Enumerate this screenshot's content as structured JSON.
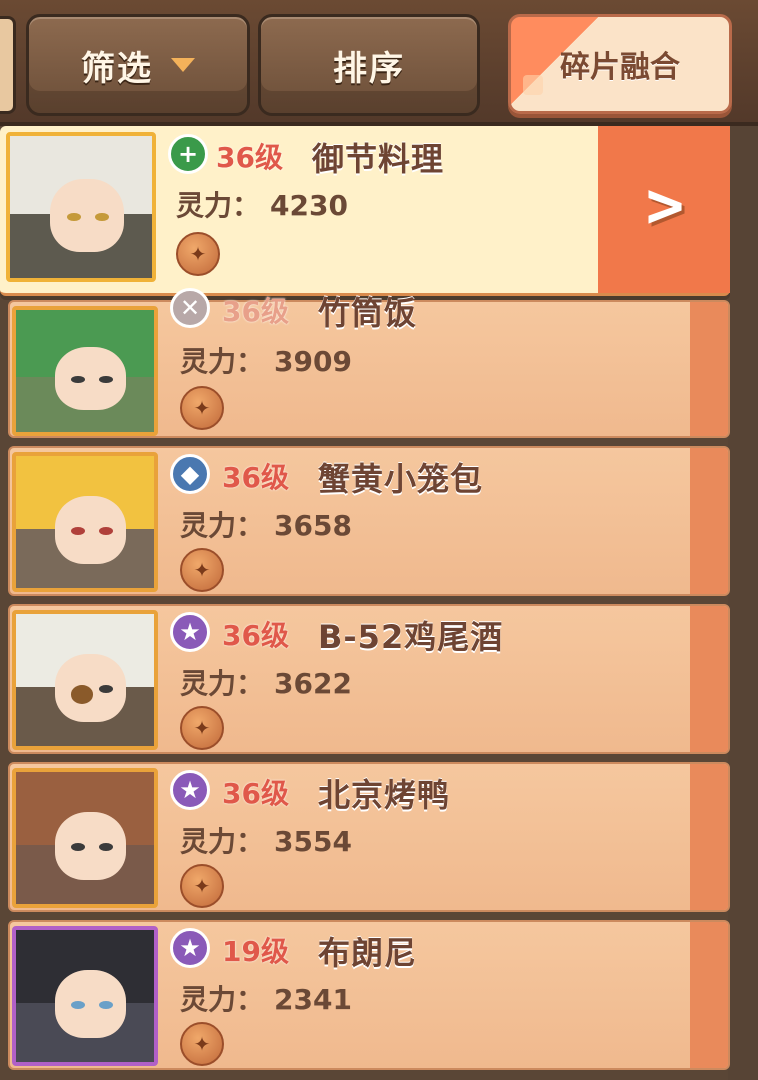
{
  "toolbar": {
    "filter_label": "筛选",
    "sort_label": "排序",
    "fuse_label": "碎片融合"
  },
  "colors": {
    "accent_orange": "#f1784a",
    "level_red": "#e0584a",
    "card_bg": "#f3c59b",
    "selected_bg": "#fff1c9"
  },
  "power_label": "灵力：",
  "characters": [
    {
      "level": "36级",
      "name": "御节料理",
      "power": "4230",
      "class_icon": "plus-icon",
      "selected": true
    },
    {
      "level": "36级",
      "name": "竹筒饭",
      "power": "3909",
      "class_icon": "swords-icon",
      "selected": false
    },
    {
      "level": "36级",
      "name": "蟹黄小笼包",
      "power": "3658",
      "class_icon": "shield-icon",
      "selected": false
    },
    {
      "level": "36级",
      "name": "B-52鸡尾酒",
      "power": "3622",
      "class_icon": "star-icon",
      "selected": false
    },
    {
      "level": "36级",
      "name": "北京烤鸭",
      "power": "3554",
      "class_icon": "star-icon",
      "selected": false
    },
    {
      "level": "19级",
      "name": "布朗尼",
      "power": "2341",
      "class_icon": "star-icon",
      "selected": false
    }
  ]
}
